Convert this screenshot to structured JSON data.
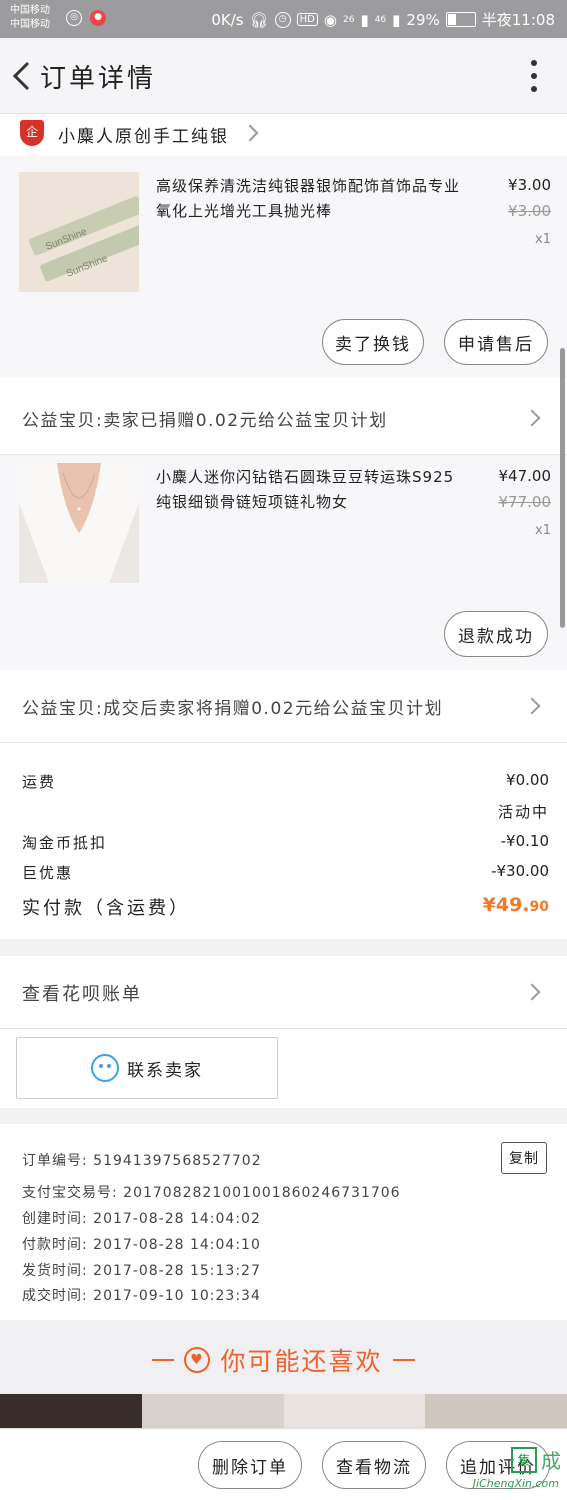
{
  "status_bar": {
    "carrier1": "中国移动",
    "carrier2": "中国移动",
    "net_speed": "0K/s",
    "hd": "HD",
    "sig1": "26",
    "sig2": "46",
    "battery": "29%",
    "time": "半夜11:08"
  },
  "nav": {
    "title": "订单详情"
  },
  "shop": {
    "name": "小麋人原创手工纯银",
    "logo_text": "企"
  },
  "items": [
    {
      "title": "高级保养清洗洁纯银器银饰配饰首饰品专业氧化上光增光工具抛光棒",
      "price": "¥3.00",
      "original_price": "¥3.00",
      "qty": "x1",
      "actions": [
        "卖了换钱",
        "申请售后"
      ]
    },
    {
      "title": "小麋人迷你闪钻锆石圆珠豆豆转运珠S925纯银细锁骨链短项链礼物女",
      "price": "¥47.00",
      "original_price": "¥77.00",
      "qty": "x1",
      "actions": [
        "退款成功"
      ]
    }
  ],
  "charity": [
    "公益宝贝:卖家已捐赠0.02元给公益宝贝计划",
    "公益宝贝:成交后卖家将捐赠0.02元给公益宝贝计划"
  ],
  "fees": {
    "shipping_label": "运费",
    "shipping_value": "¥0.00",
    "promo_tag": "活动中",
    "coin_label": "淘金币抵扣",
    "coin_value": "-¥0.10",
    "discount_label": "巨优惠",
    "discount_value": "-¥30.00",
    "total_label": "实付款（含运费）",
    "total_main": "¥49.",
    "total_cents": "90"
  },
  "huabei": {
    "label": "查看花呗账单"
  },
  "contact": {
    "label": "联系卖家"
  },
  "order_info": {
    "copy_label": "复制",
    "rows": [
      {
        "label": "订单编号:",
        "value": "51941397568527702"
      },
      {
        "label": "支付宝交易号:",
        "value": "2017082821001001860246731706"
      },
      {
        "label": "创建时间:",
        "value": "2017-08-28 14:04:02"
      },
      {
        "label": "付款时间:",
        "value": "2017-08-28 14:04:10"
      },
      {
        "label": "发货时间:",
        "value": "2017-08-28 15:13:27"
      },
      {
        "label": "成交时间:",
        "value": "2017-09-10 10:23:34"
      }
    ]
  },
  "recommend": {
    "title": "你可能还喜欢"
  },
  "bottom": {
    "delete": "删除订单",
    "logistics": "查看物流",
    "review": "追加评价"
  },
  "watermark": {
    "box": "集",
    "text": "成",
    "url": "JiChengXin.com"
  },
  "colors": {
    "accent": "#f4772a",
    "recommend": "#f0622c",
    "shop_logo": "#d9302b",
    "service_icon": "#3aa2e8"
  }
}
